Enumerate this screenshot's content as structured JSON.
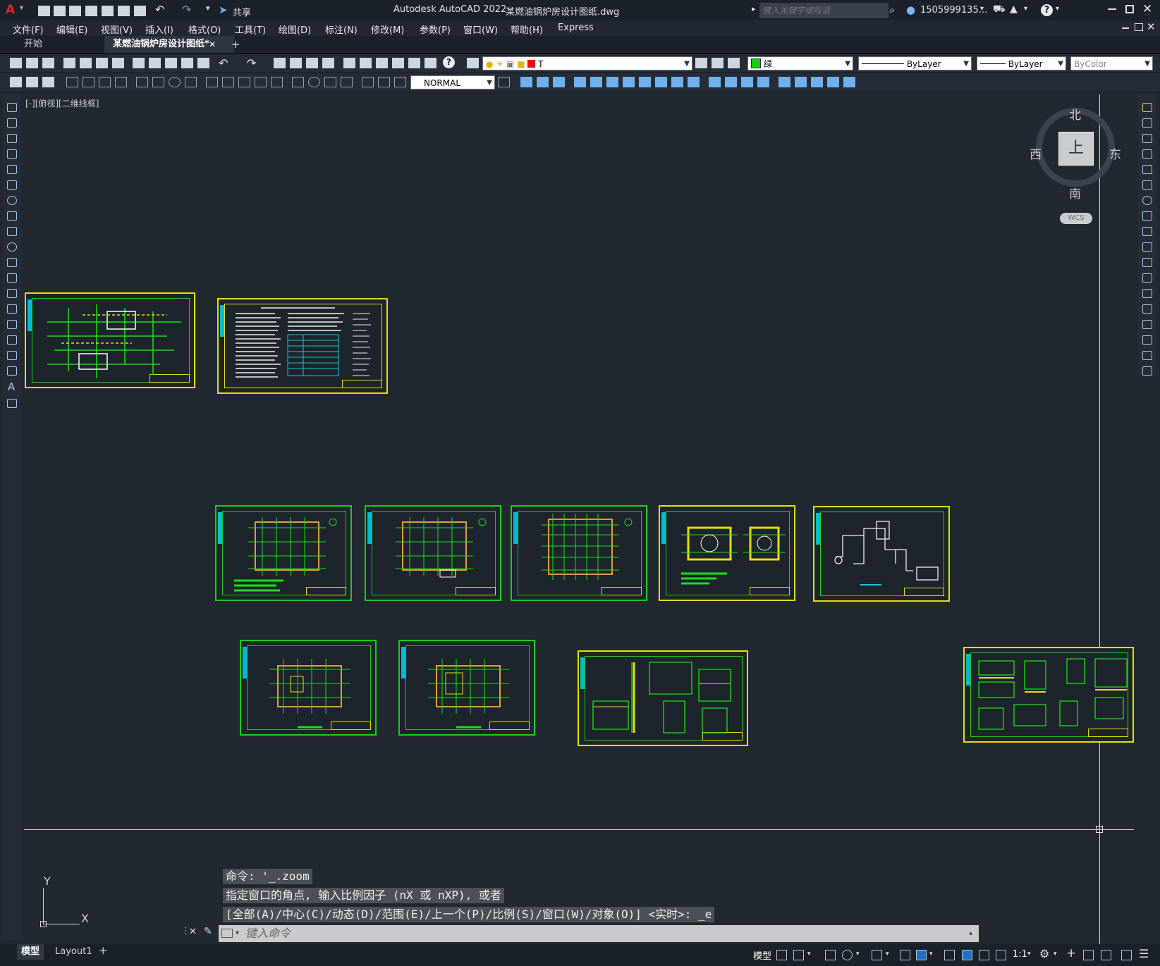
{
  "app": {
    "title": "Autodesk AutoCAD 2022",
    "filename": "某燃油锅炉房设计图纸.dwg",
    "share_label": "共享",
    "search_placeholder": "键入关键字或短语",
    "user": "1505999135...",
    "help_glyph": "?"
  },
  "menu": [
    "文件(F)",
    "编辑(E)",
    "视图(V)",
    "插入(I)",
    "格式(O)",
    "工具(T)",
    "绘图(D)",
    "标注(N)",
    "修改(M)",
    "参数(P)",
    "窗口(W)",
    "帮助(H)",
    "Express"
  ],
  "tabs": {
    "start": "开始",
    "doc": "某燃油锅炉房设计图纸*",
    "close_glyph": "✕",
    "add_glyph": "+"
  },
  "toolbar": {
    "layer_value": "T",
    "color_value": "绿",
    "linetype_value": "ByLayer",
    "lineweight_value": "ByLayer",
    "plotstyle_value": "ByColor",
    "textstyle_value": "NORMAL"
  },
  "viewport": {
    "label": "[-][俯视][二维线框]"
  },
  "viewcube": {
    "north": "北",
    "south": "南",
    "east": "东",
    "west": "西",
    "top": "上",
    "wcs": "WCS"
  },
  "ucs": {
    "x": "X",
    "y": "Y"
  },
  "command": {
    "history": [
      "命令: '_.zoom",
      "指定窗口的角点, 输入比例因子 (nX 或 nXP), 或者",
      "[全部(A)/中心(C)/动态(D)/范围(E)/上一个(P)/比例(S)/窗口(W)/对象(O)] <实时>: _e"
    ],
    "placeholder": "键入命令"
  },
  "status": {
    "model_tab": "模型",
    "layout_tab": "Layout1",
    "add_tab": "+",
    "model_button": "模型",
    "scale": "1:1"
  },
  "colors": {
    "background": "#212830",
    "sheet_yellow": "#e3e000",
    "sheet_green": "#14d014"
  }
}
